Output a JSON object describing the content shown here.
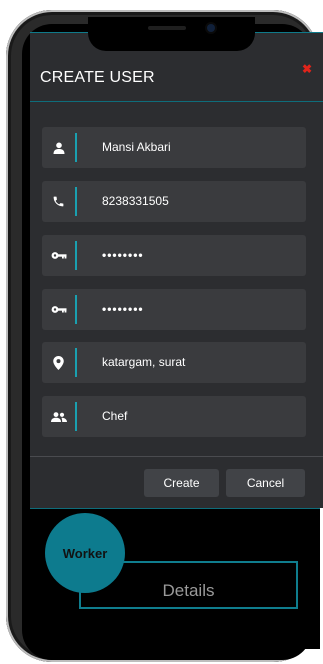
{
  "modal": {
    "title": "CREATE USER",
    "close_glyph": "✖"
  },
  "fields": {
    "name": {
      "icon": "person-icon",
      "value": "Mansi Akbari"
    },
    "phone": {
      "icon": "phone-icon",
      "value": "8238331505"
    },
    "password": {
      "icon": "key-icon",
      "value": "••••••••"
    },
    "confirm_password": {
      "icon": "key-icon",
      "value": "••••••••"
    },
    "address": {
      "icon": "location-pin-icon",
      "value": "katargam, surat"
    },
    "role": {
      "icon": "group-icon",
      "value": "Chef"
    }
  },
  "actions": {
    "create_label": "Create",
    "cancel_label": "Cancel"
  },
  "background": {
    "worker_label": "Worker",
    "details_label": "Details"
  },
  "colors": {
    "accent": "#0d7b8e",
    "modal_bg": "#2c2d30",
    "field_bg": "#3a3b3e",
    "close": "#e0241b"
  }
}
